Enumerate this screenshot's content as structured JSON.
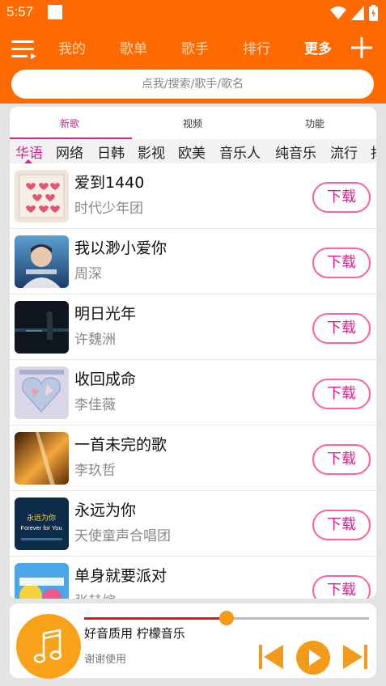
{
  "status": {
    "time": "5:57"
  },
  "nav": {
    "tabs": [
      "我的",
      "歌单",
      "歌手",
      "排行",
      "更多"
    ],
    "active_tab": 4
  },
  "search": {
    "placeholder": "点我/搜索/歌手/歌名"
  },
  "subtabs": [
    "新歌",
    "视频",
    "功能"
  ],
  "categories": [
    "华语",
    "网络",
    "日韩",
    "影视",
    "欧美",
    "音乐人",
    "纯音乐",
    "流行",
    "抖"
  ],
  "songs": [
    {
      "title": "爱到1440",
      "artist": "时代少年团",
      "download_label": "下载"
    },
    {
      "title": "我以渺小爱你",
      "artist": "周深",
      "download_label": "下载"
    },
    {
      "title": "明日光年",
      "artist": "许魏洲",
      "download_label": "下载"
    },
    {
      "title": "收回成命",
      "artist": "李佳薇",
      "download_label": "下载"
    },
    {
      "title": "一首未完的歌",
      "artist": "李玖哲",
      "download_label": "下载"
    },
    {
      "title": "永远为你",
      "artist": "天使童声合唱团",
      "download_label": "下载"
    },
    {
      "title": "单身就要派对",
      "artist": "张赫煊",
      "download_label": "下载"
    }
  ],
  "covers": {
    "cover_6_text_line1": "永远为你",
    "cover_6_text_line2": "Forever for You"
  },
  "player": {
    "title": "好音质用 柠檬音乐",
    "subtitle": "谢谢使用",
    "progress": 0.5
  },
  "colors": {
    "brand": "#ff6a00",
    "accent": "#e0208c",
    "player_accent": "#f39a1a"
  }
}
